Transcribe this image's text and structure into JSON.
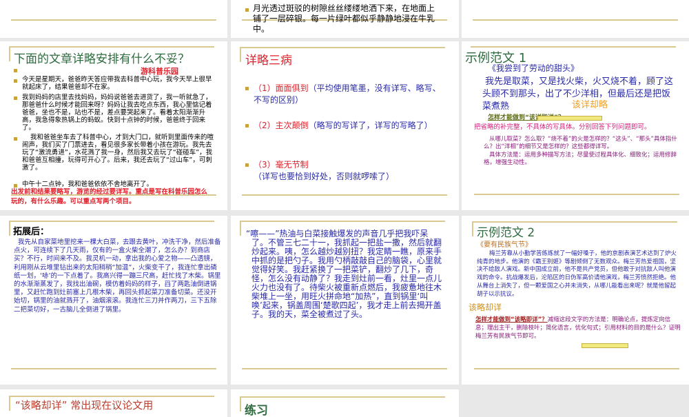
{
  "slides": {
    "s0b": {
      "bullet": "月光透过斑驳的树隙丝丝缕缕地洒下来，在地面上铺了一层碎银。每一片绿叶都似乎静静地浸在牛乳中。"
    },
    "s1": {
      "title": "下面的文章详略安排有什么不妥？",
      "subtitle": "游科普乐园",
      "bullets": [
        "今天是星期天，爸爸昨天答应带我去科普中心玩，我今天早上很早就起床了，结果爸爸却不在家。",
        "我到妈妈的店里去找妈妈，妈妈说爸爸去进货了，我一听就急了，那爸爸什么时候才能回来呀？妈妈让我去吃点东西，我心里惦记着爸爸，坐也不是，站也不是，差点要哭起来了。看着太阳渐渐升高，我急得象热锅上的蚂蚁。快到十点钟的时候，爸爸终于回来了。",
        "我和爸爸坐车去了科普中心，才到大门口，就听到里面传来的喧闹声，我们买了门票进去，看见很多家长带着小孩在游玩。我先去玩了“激流勇进”，水花溅了我一身，然后我又去玩了“碰碰车”，我和爸爸互相撞，玩得可开心了。后来，我还去玩了“过山车”，可刺激了。",
        "中午十二点钟，我和爸爸依依不舍地离开了。"
      ],
      "note": "出发前和结果要略写，游览的经过要详写。重点是写在科普乐园怎么玩的，有什么乐趣。可以重点写两个项目。"
    },
    "s2": {
      "title": "详略三病",
      "items": [
        {
          "label": "（1）面面俱到",
          "detail": "（平均使用笔墨，没有详写、略写、不写的区别）"
        },
        {
          "label": "（2）主次颠倒",
          "detail": "（略写的写详了，详写的写略了）"
        },
        {
          "label": "（3）毫无节制",
          "detail": "（详写也要恰到好处，否则就啰嗦了）"
        }
      ]
    },
    "s3": {
      "title": "示例范文 1",
      "book": "《我尝到了劳动的甜头》",
      "para": "我先是取菜，又是找火柴，火又烧不着，顾了这头顾不到那头，出了不少洋相，但最后还是把饭菜煮熟",
      "tag": "该详却略",
      "question": "怎样才能做到“该详即详”？",
      "answer": "把省略的补完整，不具体的写具体。分别回答下列问题即可。",
      "q2": "从哪儿取菜？怎么取？“烧不着”的火是怎样的？“这头”、“那头”具体指什么？出“洋相”的细节又是怎样的？这些都得详写。",
      "method": "具体方法是：运用多种描写方法；尽量使过程具体化、细致化；运用修辞格，增强生动性。"
    },
    "s4": {
      "title": "拓展后：",
      "para": "我先从自家菜地里挖来一棵大白菜，去跟去黄叶，冲洗干净，然后准备点火，可连续下了几天雨，仅有的一盒火柴全潮了，怎么办？到商店买？不行，时间来不及。我灵机一动，拿出我的心爱之物——凸透镜，利用刚从云堆里钻出来的太阳稍稍“加温”，火柴变干了，我连忙拿出磷纸一划，‘哧’的一下点着了。我高兴得一蹦三尺高，赶忙找了木柴。锅里的水渐渐蒸发了，我找出油碗，模仿着妈妈的样子，舀了两匙油倒进锅里，又赶忙跑到灶前塞上几根木柴，再回头抓起菜刀准备切菜。还没开始切，锅里的油就溅开了，油烟滚滚。我连忙三刀并作两刀，三下五除二把菜切好，一古脑儿全倒进了锅里。"
    },
    "s5": {
      "para": "“嚓——”热油与白菜接触爆发的声音几乎把我吓呆了。不管三七二十一，我抓起一把盐一撒，然后就翻炒起来。咦，怎么越炒越别扭？我定睛一瞧，原来手中抓的是把勺子。我用勺柄敲敲自己的脑袋，心里就觉得好笑。我赶紧换了一把菜铲，翻炒了几下，奇怪，怎么没有动静了？我走到灶前一看，灶里一点儿火力也没有了。待柴火被重新点燃后，我疲惫地往木柴堆上一坐，用旺火拼命地“加热”，直到锅里‘叫唤’起来，锅盖周围‘楚歌四起’，我才走上前去揭开盖子。我的天，菜全被煮过了头。"
    },
    "s6": {
      "title": "示例范文 2",
      "book": "《要有民族气节》",
      "para": "梅兰芳靠从小勤学苦练练就了一幅好嗓子，他的京剧表演艺术达到了炉火纯青的地步。他演的《霸王别姬》等剧倾倒了无数观众。梅兰芳热爱祖国，坚决不给敌人演戏。新中国成立前，他不是共产党员，但他敢于对抗敌人叫他演戏的命令。抗战爆发后，沦陷区的日伪军高价请他演戏，梅兰芳愤然拒绝。他从舞台上消失了，但一颗爱国之心并未消失，从哪儿能看出来呢？就是他留起胡子以示抗议。",
      "tag": "该略却详",
      "question": "怎样才能做到“该略即详”？",
      "answer": "减缩这段文字的方法是：明确论点，提炼定向信息；理出主干，删除枝叶；简化语言，优化句式；引用材料的目的是什么？证明梅兰芳有民族气节即可。"
    },
    "s7": {
      "title": "“该略却详” 常出现在议论文用"
    },
    "s8": {
      "title": "练习"
    }
  }
}
